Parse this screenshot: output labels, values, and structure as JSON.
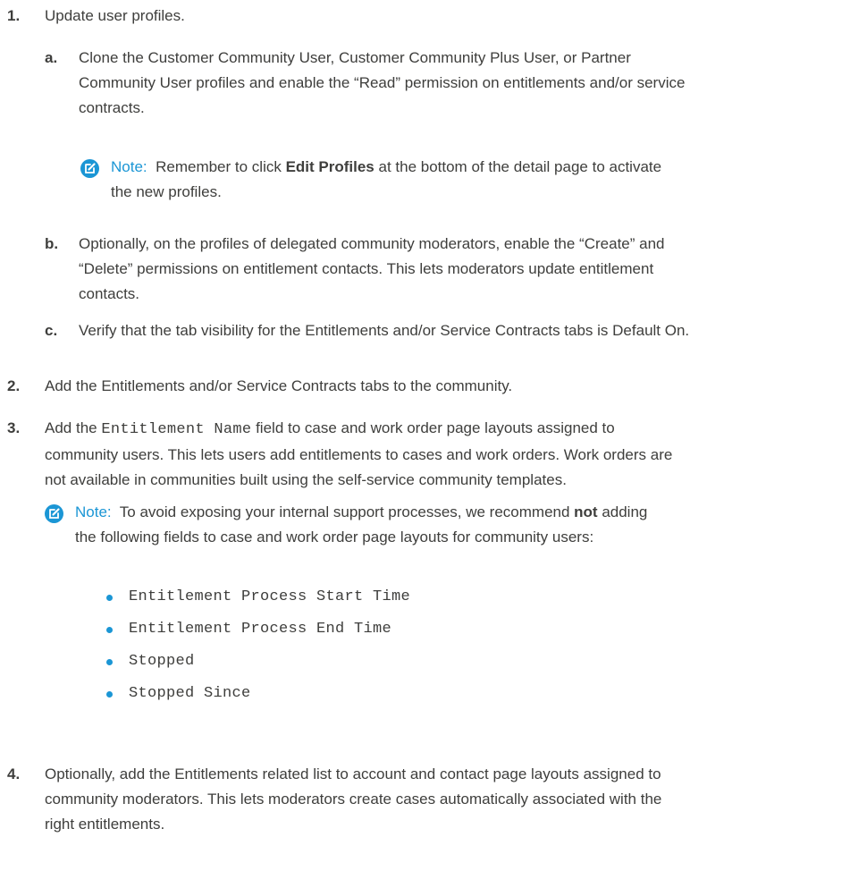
{
  "steps": [
    {
      "num": "1.",
      "text": "Update user profiles."
    },
    {
      "num": "2.",
      "text": "Add the Entitlements and/or Service Contracts tabs to the community."
    },
    {
      "num": "3.",
      "pre": "Add the ",
      "code": "Entitlement Name",
      "line1_post": " field to case and work order page layouts assigned to",
      "line2": "community users. This lets users add entitlements to cases and work orders. Work orders are",
      "line3": "not available in communities built using the self-service community templates."
    },
    {
      "num": "4.",
      "line1": "Optionally, add the Entitlements related list to account and contact page layouts assigned to",
      "line2": "community moderators. This lets moderators create cases automatically associated with the",
      "line3": "right entitlements."
    }
  ],
  "substeps": [
    {
      "num": "a.",
      "line1": "Clone the Customer Community User, Customer Community Plus User, or Partner",
      "line2": "Community User profiles and enable the “Read” permission on entitlements and/or service",
      "line3": "contracts."
    },
    {
      "num": "b.",
      "line1": "Optionally, on the profiles of delegated community moderators, enable the “Create” and",
      "line2": "“Delete” permissions on entitlement contacts. This lets moderators update entitlement",
      "line3": "contacts."
    },
    {
      "num": "c.",
      "line1": "Verify that the tab visibility for the Entitlements and/or Service Contracts tabs is Default On."
    }
  ],
  "note1": {
    "label": "Note:",
    "pre": "Remember to click ",
    "bold": "Edit Profiles",
    "post": " at the bottom of the detail page to activate",
    "line2": "the new profiles."
  },
  "note2": {
    "label": "Note:",
    "pre": "To avoid exposing your internal support processes, we recommend ",
    "bold": "not",
    "post": " adding",
    "line2": "the following fields to case and work order page layouts for community users:"
  },
  "fields": [
    "Entitlement Process Start Time",
    "Entitlement Process End Time",
    "Stopped",
    "Stopped Since"
  ],
  "accent_color": "#1b96d5",
  "icons": {
    "note": "edit-note-icon",
    "bullet": "bullet-dot"
  }
}
